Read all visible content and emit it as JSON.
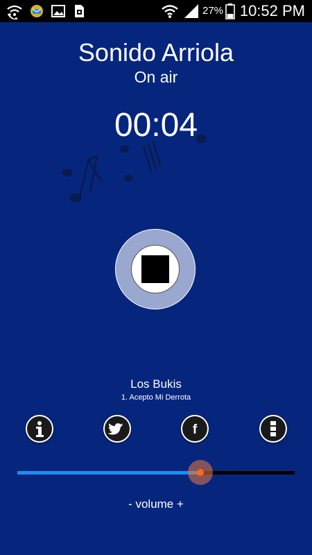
{
  "status_bar": {
    "battery_percent": "27%",
    "time": "10:52 PM",
    "icons": [
      "wifi-calling-icon",
      "mail-badge-icon",
      "gallery-icon",
      "sim-toolkit-icon",
      "wifi-icon",
      "signal-icon",
      "battery-icon"
    ]
  },
  "player": {
    "station_name": "Sonido Arriola",
    "status": "On air",
    "elapsed": "00:04",
    "artist": "Los Bukis",
    "track": "1. Acepto Mi Derrota",
    "control_icon": "stop-icon"
  },
  "social": {
    "buttons": [
      "info-icon",
      "twitter-icon",
      "facebook-icon",
      "menu-icon"
    ],
    "facebook_glyph": "f"
  },
  "volume": {
    "label": "- volume +",
    "level": 0.66
  },
  "colors": {
    "background": "#06267e",
    "accent": "#1f8cf0",
    "thumb": "#ff6a10"
  }
}
